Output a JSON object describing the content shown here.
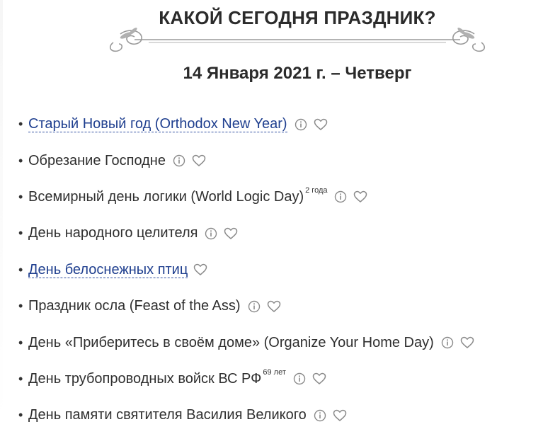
{
  "header": {
    "title": "КАКОЙ СЕГОДНЯ ПРАЗДНИК?",
    "date": "14 Января 2021 г. – Четверг"
  },
  "holidays": [
    {
      "bullet": "•",
      "label": "Старый Новый год (Orthodox New Year)",
      "link": true,
      "sup": "",
      "has_info": true,
      "has_heart": true
    },
    {
      "bullet": "•",
      "label": "Обрезание Господне",
      "link": false,
      "sup": "",
      "has_info": true,
      "has_heart": true
    },
    {
      "bullet": "•",
      "label": "Всемирный день логики (World Logic Day)",
      "link": false,
      "sup": "2 года",
      "has_info": true,
      "has_heart": true
    },
    {
      "bullet": "•",
      "label": "День народного целителя",
      "link": false,
      "sup": "",
      "has_info": true,
      "has_heart": true
    },
    {
      "bullet": "•",
      "label": "День белоснежных птиц",
      "link": true,
      "sup": "",
      "has_info": false,
      "has_heart": true
    },
    {
      "bullet": "•",
      "label": "Праздник осла (Feast of the Ass)",
      "link": false,
      "sup": "",
      "has_info": true,
      "has_heart": true
    },
    {
      "bullet": "•",
      "label": "День «Приберитесь в своём доме» (Organize Your Home Day)",
      "link": false,
      "sup": "",
      "has_info": true,
      "has_heart": true
    },
    {
      "bullet": "•",
      "label": "День трубопроводных войск ВС РФ",
      "link": false,
      "sup": "69 лет",
      "has_info": true,
      "has_heart": true
    },
    {
      "bullet": "•",
      "label": "День памяти святителя Василия Великого",
      "link": false,
      "sup": "",
      "has_info": true,
      "has_heart": true
    }
  ],
  "icons": {
    "info": "info-icon",
    "favorite": "heart-icon",
    "divider": "ornament-divider"
  },
  "colors": {
    "link": "#1f3f8f",
    "text": "#2f2f2f",
    "icon": "#8a8a8a",
    "ornament": "#9a9a9a"
  }
}
